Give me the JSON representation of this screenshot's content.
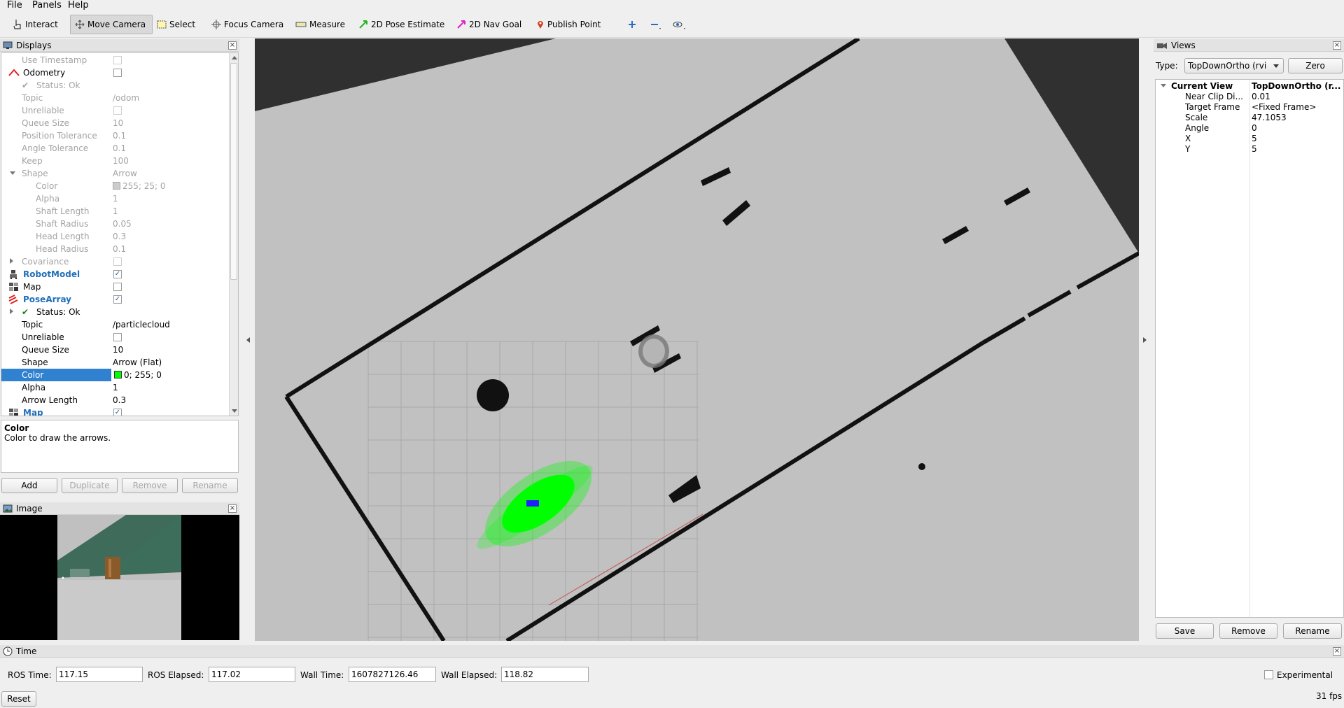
{
  "menu": {
    "file": "File",
    "panels": "Panels",
    "help": "Help"
  },
  "toolbar": {
    "interact": "Interact",
    "move_camera": "Move Camera",
    "select": "Select",
    "focus_camera": "Focus Camera",
    "measure": "Measure",
    "pose_estimate": "2D Pose Estimate",
    "nav_goal": "2D Nav Goal",
    "publish_point": "Publish Point"
  },
  "displays": {
    "title": "Displays",
    "rows": [
      {
        "key": "Use Timestamp",
        "value": ""
      },
      {
        "key": "Odometry",
        "value": ""
      },
      {
        "key": "Status: Ok",
        "value": ""
      },
      {
        "key": "Topic",
        "value": "/odom"
      },
      {
        "key": "Unreliable",
        "value": ""
      },
      {
        "key": "Queue Size",
        "value": "10"
      },
      {
        "key": "Position Tolerance",
        "value": "0.1"
      },
      {
        "key": "Angle Tolerance",
        "value": "0.1"
      },
      {
        "key": "Keep",
        "value": "100"
      },
      {
        "key": "Shape",
        "value": "Arrow"
      },
      {
        "key": "Color",
        "value": "255; 25; 0"
      },
      {
        "key": "Alpha",
        "value": "1"
      },
      {
        "key": "Shaft Length",
        "value": "1"
      },
      {
        "key": "Shaft Radius",
        "value": "0.05"
      },
      {
        "key": "Head Length",
        "value": "0.3"
      },
      {
        "key": "Head Radius",
        "value": "0.1"
      },
      {
        "key": "Covariance",
        "value": ""
      },
      {
        "key": "RobotModel",
        "value": ""
      },
      {
        "key": "Map",
        "value": ""
      },
      {
        "key": "PoseArray",
        "value": ""
      },
      {
        "key": "Status: Ok",
        "value": ""
      },
      {
        "key": "Topic",
        "value": "/particlecloud"
      },
      {
        "key": "Unreliable",
        "value": ""
      },
      {
        "key": "Queue Size",
        "value": "10"
      },
      {
        "key": "Shape",
        "value": "Arrow (Flat)"
      },
      {
        "key": "Color",
        "value": "0; 255; 0"
      },
      {
        "key": "Alpha",
        "value": "1"
      },
      {
        "key": "Arrow Length",
        "value": "0.3"
      },
      {
        "key": "Map",
        "value": ""
      }
    ],
    "desc_title": "Color",
    "desc_text": "Color to draw the arrows.",
    "buttons": {
      "add": "Add",
      "duplicate": "Duplicate",
      "remove": "Remove",
      "rename": "Rename"
    }
  },
  "image_panel": {
    "title": "Image"
  },
  "views": {
    "title": "Views",
    "type_label": "Type:",
    "type_value": "TopDownOrtho (rvi",
    "zero": "Zero",
    "rows": [
      {
        "key": "Current View",
        "value": "TopDownOrtho (r..."
      },
      {
        "key": "Near Clip Di...",
        "value": "0.01"
      },
      {
        "key": "Target Frame",
        "value": "<Fixed Frame>"
      },
      {
        "key": "Scale",
        "value": "47.1053"
      },
      {
        "key": "Angle",
        "value": "0"
      },
      {
        "key": "X",
        "value": "5"
      },
      {
        "key": "Y",
        "value": "5"
      }
    ],
    "buttons": {
      "save": "Save",
      "remove": "Remove",
      "rename": "Rename"
    }
  },
  "time": {
    "title": "Time",
    "ros_time_label": "ROS Time:",
    "ros_time": "117.15",
    "ros_elapsed_label": "ROS Elapsed:",
    "ros_elapsed": "117.02",
    "wall_time_label": "Wall Time:",
    "wall_time": "1607827126.46",
    "wall_elapsed_label": "Wall Elapsed:",
    "wall_elapsed": "118.82",
    "experimental": "Experimental",
    "reset": "Reset",
    "fps": "31 fps"
  },
  "colors": {
    "selection": "#3082d0",
    "particles": "#00ff00",
    "odom_color": "#ff1900",
    "panel_bg": "#efefef"
  }
}
